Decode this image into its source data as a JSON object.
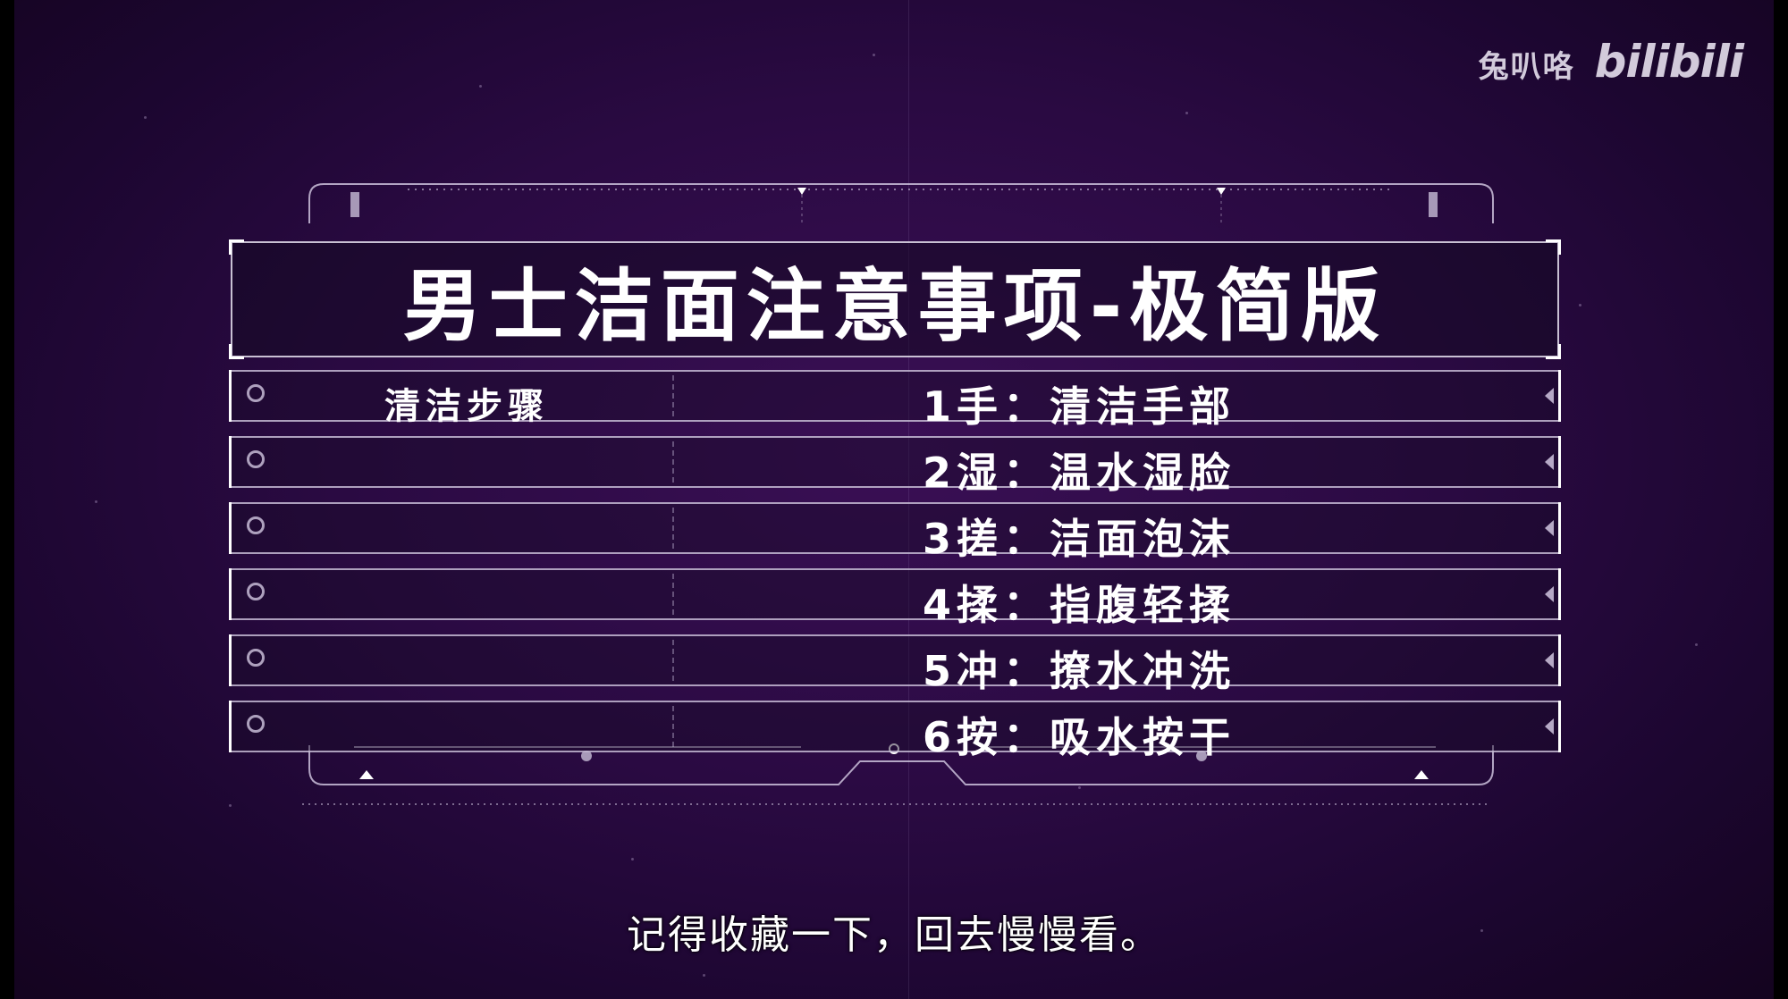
{
  "watermark": {
    "channel": "兔叭咯",
    "logo": "bilibili"
  },
  "card": {
    "title": "男士洁面注意事项-极简版",
    "section_label": "清洁步骤",
    "steps": [
      "1手：清洁手部",
      "2湿：温水湿脸",
      "3搓：洁面泡沫",
      "4揉：指腹轻揉",
      "5冲：撩水冲洗",
      "6按：吸水按干"
    ]
  },
  "subtitle": "记得收藏一下，回去慢慢看。"
}
